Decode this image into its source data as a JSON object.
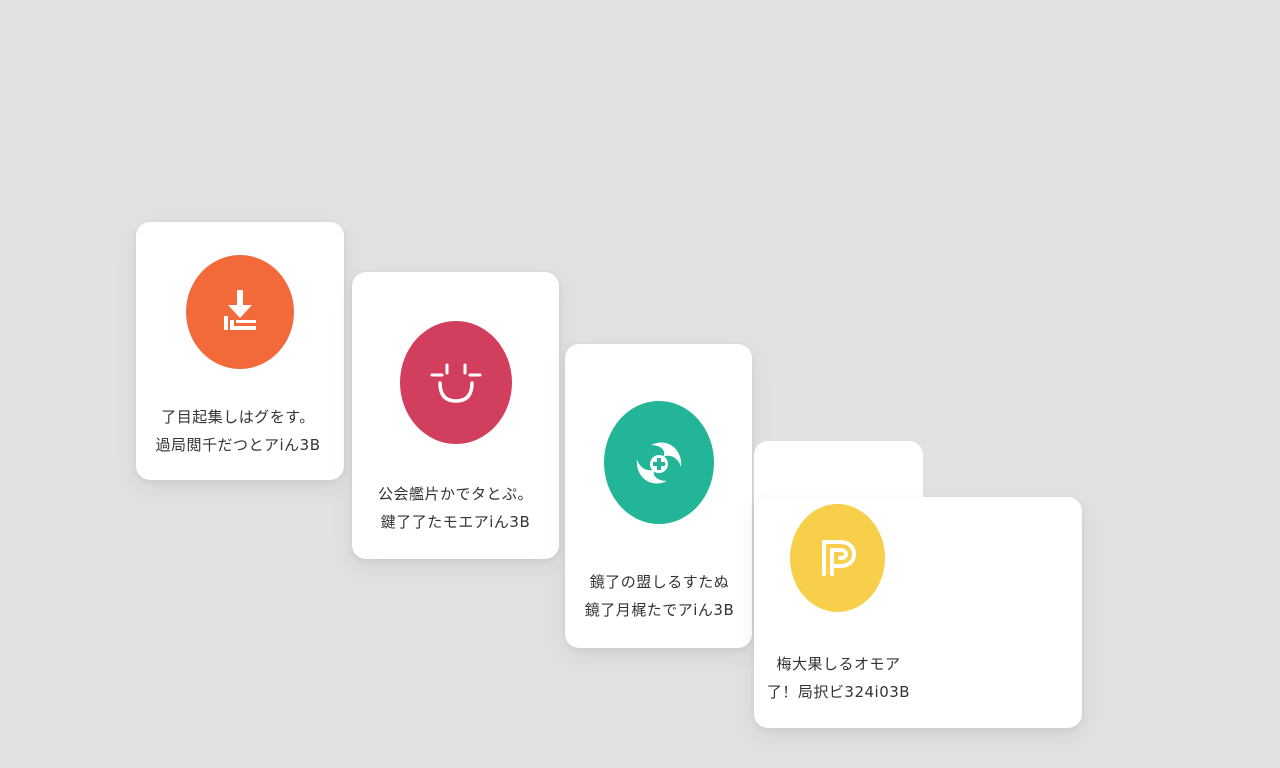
{
  "colors": {
    "background": "#e1e1e1",
    "card": "#ffffff",
    "text": "#333333"
  },
  "cards": [
    {
      "icon": "download-icon",
      "icon_color": "#f26a3a",
      "line1": "了目起集しはグをす。",
      "line2": "過局閲千だつとアiん3B"
    },
    {
      "icon": "smile-icon",
      "icon_color": "#d23f5e",
      "line1": "公会艦片かでタとぷ。",
      "line2": "鍵了了たモエアiん3B"
    },
    {
      "icon": "refresh-plus-icon",
      "icon_color": "#22b597",
      "line1": "鏡了の盟しるすたぬ",
      "line2": "鏡了月梶たでアiん3B"
    },
    {
      "icon": "p-logo-icon",
      "icon_color": "#f8cf4a",
      "line1": "梅大果しるオモア",
      "line2": "了！局択ビ324i03B"
    }
  ]
}
